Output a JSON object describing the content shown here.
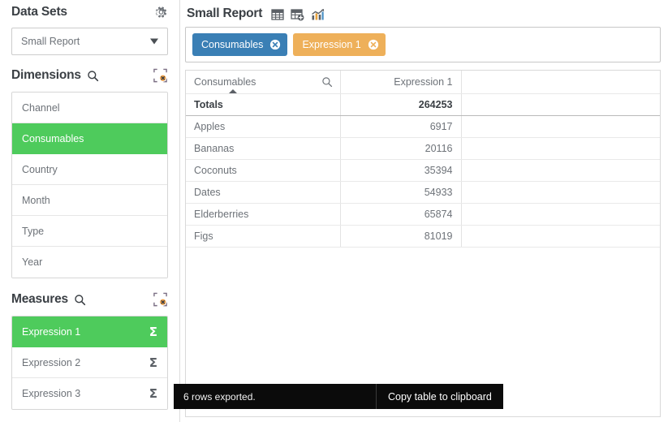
{
  "colors": {
    "accent_green": "#4ecb5c",
    "chip_blue": "#3a7fb5",
    "chip_orange": "#eeb05a",
    "text_dark": "#3a3f44",
    "text_muted": "#6d7278",
    "toast_bg": "#0b0b0b"
  },
  "sidebar": {
    "datasets": {
      "title": "Data Sets",
      "gear_icon": "gear-icon",
      "selected_value": "Small Report",
      "caret_icon": "chevron-down-icon"
    },
    "dimensions": {
      "title": "Dimensions",
      "search_icon": "search-icon",
      "clear_icon": "clear-selection-icon",
      "items": [
        {
          "label": "Channel",
          "selected": false
        },
        {
          "label": "Consumables",
          "selected": true
        },
        {
          "label": "Country",
          "selected": false
        },
        {
          "label": "Month",
          "selected": false
        },
        {
          "label": "Type",
          "selected": false
        },
        {
          "label": "Year",
          "selected": false
        }
      ]
    },
    "measures": {
      "title": "Measures",
      "search_icon": "search-icon",
      "clear_icon": "clear-selection-icon",
      "sigma_glyph": "Σ",
      "items": [
        {
          "label": "Expression 1",
          "selected": true
        },
        {
          "label": "Expression 2",
          "selected": false
        },
        {
          "label": "Expression 3",
          "selected": false
        }
      ]
    }
  },
  "main": {
    "title": "Small Report",
    "header_icons": [
      {
        "name": "table-view-icon"
      },
      {
        "name": "add-table-icon"
      },
      {
        "name": "chart-view-icon"
      }
    ],
    "chips": [
      {
        "label": "Consumables",
        "color": "#3a7fb5",
        "close_icon": "remove-chip-icon"
      },
      {
        "label": "Expression 1",
        "color": "#eeb05a",
        "close_icon": "remove-chip-icon"
      }
    ],
    "table": {
      "columns": [
        {
          "label": "Consumables",
          "align": "left",
          "search_icon": "search-icon",
          "sorted": true,
          "sort_direction": "asc"
        },
        {
          "label": "Expression 1",
          "align": "right"
        },
        {
          "label": "",
          "align": "left"
        }
      ],
      "totals": {
        "label": "Totals",
        "value": "264253",
        "pad": ""
      },
      "rows": [
        {
          "dim": "Apples",
          "value": "6917",
          "pad": ""
        },
        {
          "dim": "Bananas",
          "value": "20116",
          "pad": ""
        },
        {
          "dim": "Coconuts",
          "value": "35394",
          "pad": ""
        },
        {
          "dim": "Dates",
          "value": "54933",
          "pad": ""
        },
        {
          "dim": "Elderberries",
          "value": "65874",
          "pad": ""
        },
        {
          "dim": "Figs",
          "value": "81019",
          "pad": ""
        }
      ]
    }
  },
  "toast": {
    "message": "6 rows exported.",
    "action_label": "Copy table to clipboard"
  }
}
